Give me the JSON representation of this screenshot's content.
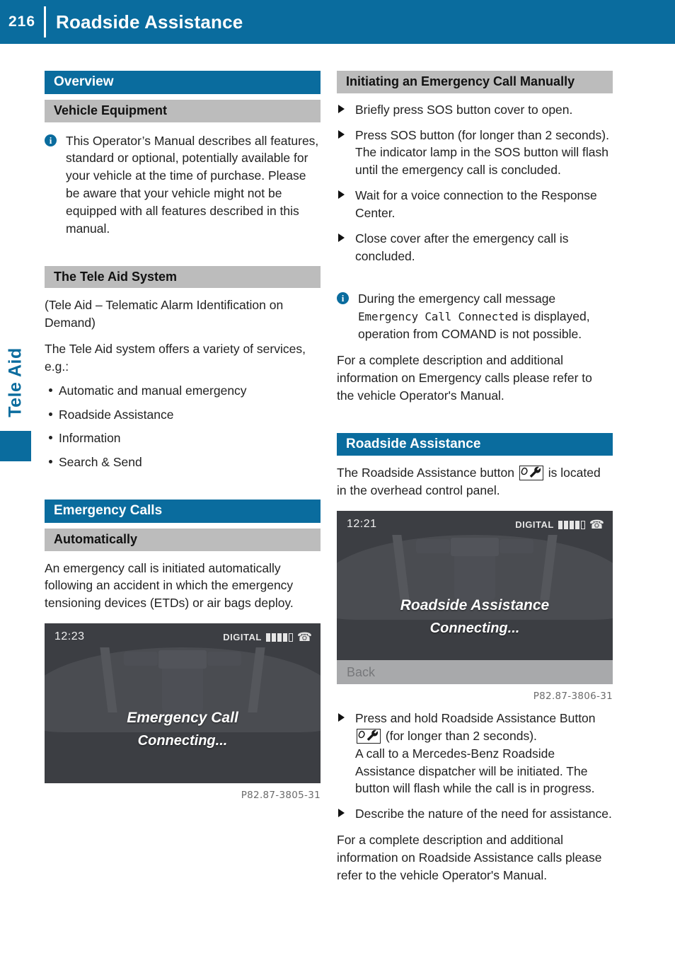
{
  "header": {
    "page_number": "216",
    "title": "Roadside Assistance"
  },
  "side_tab": {
    "label": "Tele Aid"
  },
  "colors": {
    "brand_blue": "#0a6c9e",
    "heading_gray": "#bcbcbc",
    "screen_bg": "#3c3e43"
  },
  "left_column": {
    "overview_heading": "Overview",
    "vehicle_equipment_heading": "Vehicle Equipment",
    "vehicle_equipment_note": "This Operator’s Manual describes all features, standard or optional, potentially available for your vehicle at the time of purchase. Please be aware that your vehicle might not be equipped with all features described in this manual.",
    "tele_aid_heading": "The Tele Aid System",
    "tele_aid_expansion": "(Tele Aid – Telematic Alarm Identification on Demand)",
    "tele_aid_intro": "The Tele Aid system offers a variety of services, e.g.:",
    "services": [
      "Automatic and manual emergency",
      "Roadside Assistance",
      "Information",
      "Search & Send"
    ],
    "emergency_calls_heading": "Emergency Calls",
    "automatically_heading": "Automatically",
    "automatically_text": "An emergency call is initiated automatically following an accident in which the emergency tensioning devices (ETDs) or air bags deploy.",
    "figure": {
      "time": "12:23",
      "network_label": "DIGITAL",
      "signal_bars_filled": 4,
      "signal_bars_total": 5,
      "message_line1": "Emergency Call",
      "message_line2": "Connecting...",
      "caption": "P82.87-3805-31"
    }
  },
  "right_column": {
    "manual_call_heading": "Initiating an Emergency Call Manually",
    "manual_steps": [
      "Briefly press SOS button cover to open.",
      "Press SOS button (for longer than 2 seconds).\nThe indicator lamp in the SOS button will flash until the emergency call is concluded.",
      "Wait for a voice connection to the Response Center.",
      "Close cover after the emergency call is concluded."
    ],
    "comand_note_prefix": "During the emergency call message",
    "comand_note_mono": "Emergency Call Connected",
    "comand_note_suffix": "is displayed, operation from COMAND is not possible.",
    "emergency_refer_text": "For a complete description and additional information on Emergency calls please refer to the vehicle Operator's Manual.",
    "roadside_heading": "Roadside Assistance",
    "roadside_button_text_before": "The Roadside Assistance button",
    "roadside_button_text_after": "is located in the overhead control panel.",
    "figure": {
      "time": "12:21",
      "network_label": "DIGITAL",
      "signal_bars_filled": 4,
      "signal_bars_total": 5,
      "message_line1": "Roadside Assistance",
      "message_line2": "Connecting...",
      "back_label": "Back",
      "caption": "P82.87-3806-31"
    },
    "roadside_step1_before": "Press and hold Roadside Assistance Button",
    "roadside_step1_after": "(for longer than 2 seconds).\nA call to a Mercedes-Benz Roadside Assistance dispatcher will be initiated. The button will flash while the call is in progress.",
    "roadside_step2": "Describe the nature of the need for assistance.",
    "roadside_refer_text": "For a complete description and additional information on Roadside Assistance calls please refer to the vehicle Operator's Manual."
  }
}
